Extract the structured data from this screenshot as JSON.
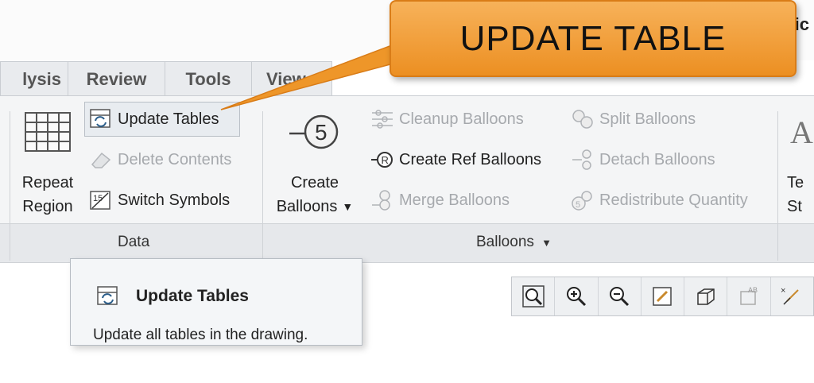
{
  "window": {
    "title_fragment": "ic"
  },
  "callout": {
    "text": "UPDATE TABLE"
  },
  "tabs": [
    "lysis",
    "Review",
    "Tools",
    "View"
  ],
  "ribbon": {
    "data_group": {
      "label": "Data",
      "repeat_region": {
        "line1": "Repeat",
        "line2": "Region"
      },
      "update_tables": "Update Tables",
      "delete_contents": "Delete Contents",
      "switch_symbols": "Switch Symbols"
    },
    "balloons_group": {
      "label": "Balloons",
      "create_balloons": {
        "line1": "Create",
        "line2": "Balloons"
      },
      "cleanup_balloons": "Cleanup Balloons",
      "create_ref_balloons": "Create Ref Balloons",
      "merge_balloons": "Merge Balloons",
      "split_balloons": "Split Balloons",
      "detach_balloons": "Detach Balloons",
      "redistribute_quantity": "Redistribute Quantity"
    },
    "text_style": {
      "line1": "Te",
      "line2": "St"
    }
  },
  "tooltip": {
    "title": "Update Tables",
    "description": "Update all tables in the drawing."
  },
  "graphics_toolbar": {
    "icons": [
      "refit-icon",
      "zoom-in-icon",
      "zoom-out-icon",
      "repaint-icon",
      "display-style-icon",
      "annotation-display-icon",
      "datum-display-icon"
    ]
  }
}
